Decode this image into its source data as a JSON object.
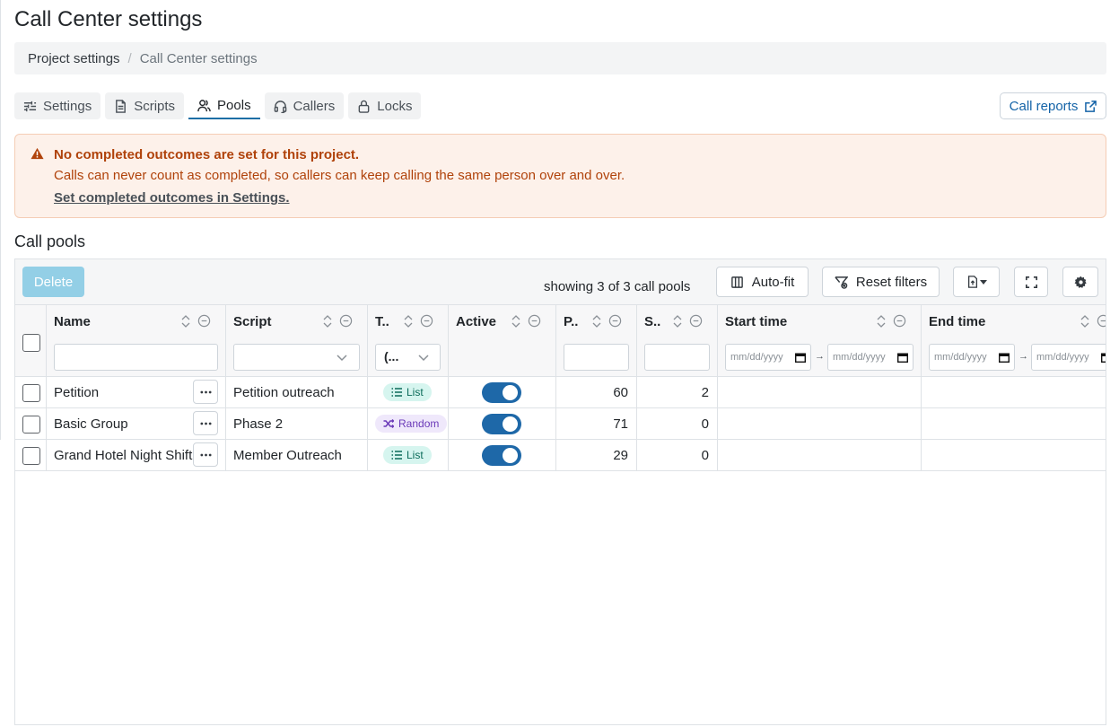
{
  "page": {
    "title": "Call Center settings"
  },
  "breadcrumb": {
    "items": [
      "Project settings",
      "Call Center settings"
    ],
    "separator": "/"
  },
  "tabs": [
    {
      "label": "Settings",
      "icon": "sliders-icon"
    },
    {
      "label": "Scripts",
      "icon": "document-icon"
    },
    {
      "label": "Pools",
      "icon": "users-icon",
      "active": true
    },
    {
      "label": "Callers",
      "icon": "headset-icon"
    },
    {
      "label": "Locks",
      "icon": "lock-icon"
    }
  ],
  "call_reports": {
    "label": "Call reports",
    "icon": "external-link-icon"
  },
  "alert": {
    "title": "No completed outcomes are set for this project.",
    "body": "Calls can never count as completed, so callers can keep calling the same person over and over.",
    "link": "Set completed outcomes in Settings.",
    "icon": "warning-triangle-icon"
  },
  "section": {
    "title": "Call pools"
  },
  "toolbar": {
    "delete_label": "Delete",
    "showing": "showing 3 of 3 call pools",
    "autofit_label": "Auto-fit",
    "reset_filters_label": "Reset filters"
  },
  "columns": {
    "name": "Name",
    "script": "Script",
    "type": "T..",
    "active": "Active",
    "p": "P..",
    "s": "S..",
    "start_time": "Start time",
    "end_time": "End time"
  },
  "filters": {
    "type_value": "(...",
    "date_placeholder": "mm/dd/yyyy",
    "range_arrow": "→"
  },
  "rows": [
    {
      "name": "Petition",
      "script": "Petition outreach",
      "type": "List",
      "active": true,
      "p": "60",
      "s": "2"
    },
    {
      "name": "Basic Group",
      "script": "Phase 2",
      "type": "Random",
      "active": true,
      "p": "71",
      "s": "0"
    },
    {
      "name": "Grand Hotel Night Shift",
      "script": "Member Outreach",
      "type": "List",
      "active": true,
      "p": "29",
      "s": "0"
    }
  ],
  "colors": {
    "primary": "#1e68a8",
    "link": "#1564a8",
    "warning_text": "#b0420a",
    "warning_bg": "#fdf1ea",
    "delete_disabled": "#93cfe6"
  }
}
